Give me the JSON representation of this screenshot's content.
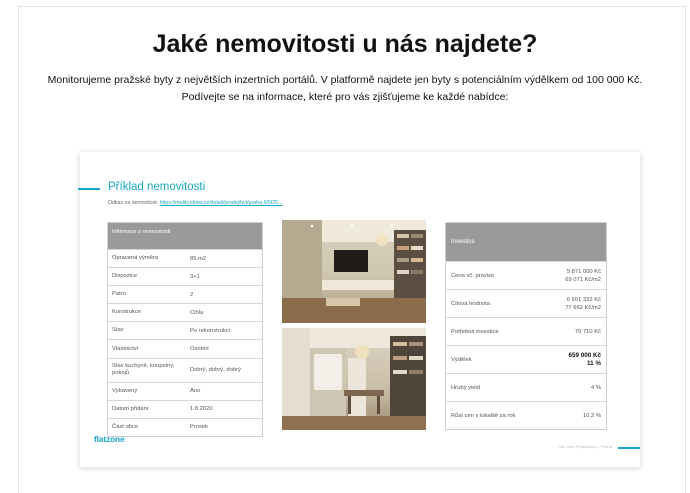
{
  "page": {
    "heading": "Jaké nemovitosti u nás najdete?",
    "intro_line1": "Monitorujeme pražské byty z největších inzertních portálů. V platformě najdete jen byty s potenciálním výdělkem od 100 000 Kč.",
    "intro_line2": "Podívejte se na informace, které pro vás zjišťujeme ke každé nabídce:"
  },
  "card": {
    "title": "Příklad nemovitosti",
    "link_label": "Odkaz na nemovitost:",
    "link_url": "https://reality.idnes.cz/detail/prodej/byt/praha-9/5f25...",
    "info_header": "Informace o nemovitosti",
    "info_rows": [
      {
        "k": "Opravená výměra",
        "v": "85 m2"
      },
      {
        "k": "Dispozice",
        "v": "3+1"
      },
      {
        "k": "Patro",
        "v": "2"
      },
      {
        "k": "Konstrukce",
        "v": "Cihla"
      },
      {
        "k": "Stav",
        "v": "Po rekonstrukci"
      },
      {
        "k": "Vlastnictví",
        "v": "Osobní"
      },
      {
        "k": "Stav kuchyně, koupelny, pokojů",
        "v": "Dobrý, dobrý, dobrý"
      },
      {
        "k": "Vybavený",
        "v": "Ano"
      },
      {
        "k": "Datum přidání",
        "v": "1.8.2020"
      },
      {
        "k": "Část obce",
        "v": "Prosek"
      }
    ],
    "inv_header": "Investice",
    "inv_rows": [
      {
        "k": "Cena vč. provize",
        "v1": "5 871 000 Kč",
        "v2": "69 071 Kč/m2"
      },
      {
        "k": "Cílová hodnota",
        "v1": "6 601 332 Kč",
        "v2": "77 662 Kč/m2"
      },
      {
        "k": "Potřebná investice",
        "v1": "70 710 Kč",
        "v2": ""
      },
      {
        "k": "Výdělek",
        "v1": "659 000 Kč",
        "v2": "11 %"
      },
      {
        "k": "Hrubý yield",
        "v1": "4 %",
        "v2": ""
      },
      {
        "k": "Růst cen v lokalitě za rok",
        "v1": "10,2 %",
        "v2": ""
      }
    ],
    "logo": "flatzone",
    "footer": "Flat Zone Podpůrkovy – Praha"
  }
}
